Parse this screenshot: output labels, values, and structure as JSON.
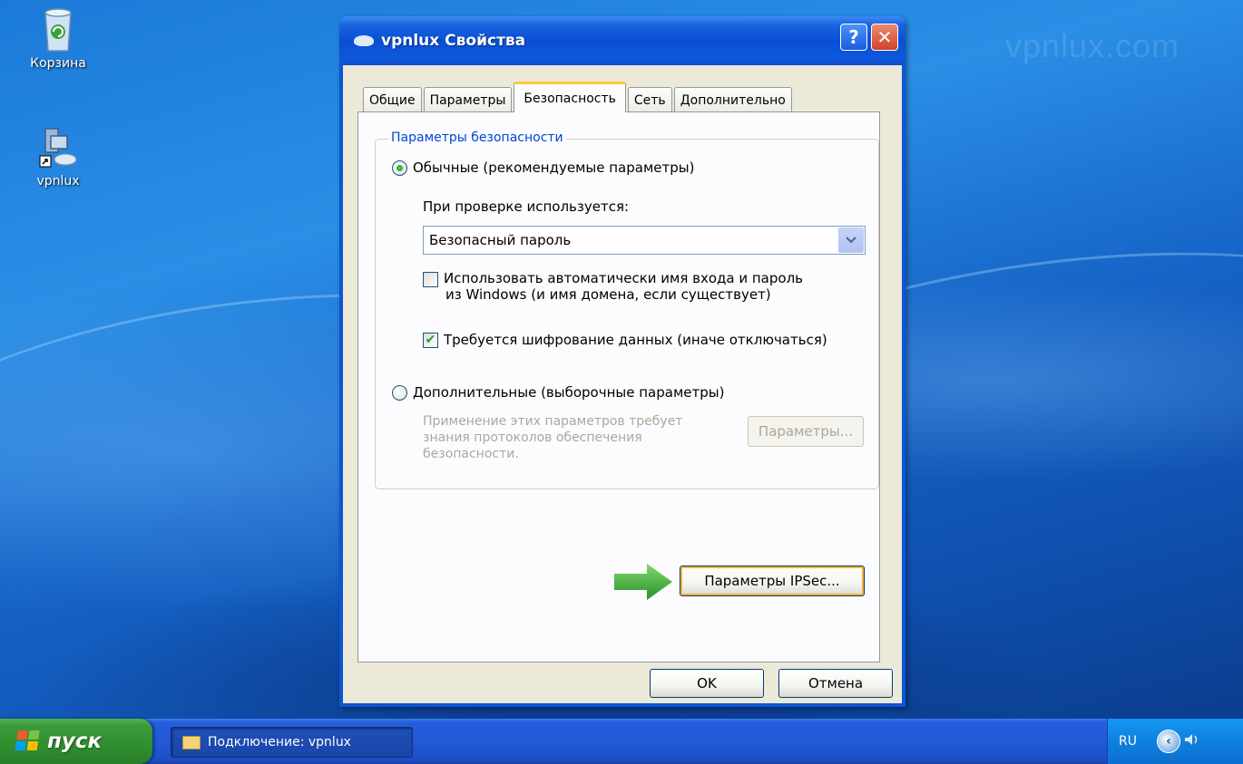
{
  "desktop": {
    "watermark": "vpnlux.com",
    "icons": [
      {
        "label": "Корзина",
        "icon": "recycle-bin-icon"
      },
      {
        "label": "vpnlux",
        "icon": "network-connection-icon"
      }
    ]
  },
  "window": {
    "title": "vpnlux Свойства",
    "help_label": "?",
    "close_label": "✕",
    "tabs": [
      {
        "label": "Общие"
      },
      {
        "label": "Параметры"
      },
      {
        "label": "Безопасность"
      },
      {
        "label": "Сеть"
      },
      {
        "label": "Дополнительно"
      }
    ],
    "active_tab": "Безопасность",
    "security": {
      "group_title": "Параметры безопасности",
      "radio_typical": "Обычные (рекомендуемые параметры)",
      "verify_label": "При проверке используется:",
      "verify_select_value": "Безопасный пароль",
      "auto_login_line1": "Использовать автоматически имя входа и пароль",
      "auto_login_line2": "из Windows (и имя домена, если существует)",
      "auto_login_checked": false,
      "require_encryption": "Требуется шифрование данных (иначе отключаться)",
      "require_encryption_checked": true,
      "radio_advanced": "Дополнительные (выборочные параметры)",
      "advanced_note_line1": "Применение этих параметров требует",
      "advanced_note_line2": "знания протоколов обеспечения",
      "advanced_note_line3": "безопасности.",
      "advanced_settings_button": "Параметры...",
      "ipsec_button": "Параметры IPSec..."
    },
    "ok_button": "OK",
    "cancel_button": "Отмена"
  },
  "taskbar": {
    "start_label": "пуск",
    "task_item": "Подключение: vpnlux",
    "language": "RU"
  },
  "colors": {
    "title_bar": "#0a4fd4",
    "dialog_bg": "#ece9d8",
    "group_title": "#0046d5",
    "active_tab_accent": "#ffc83c",
    "start_button": "#2f8f2f",
    "arrow": "#3aa53a"
  }
}
